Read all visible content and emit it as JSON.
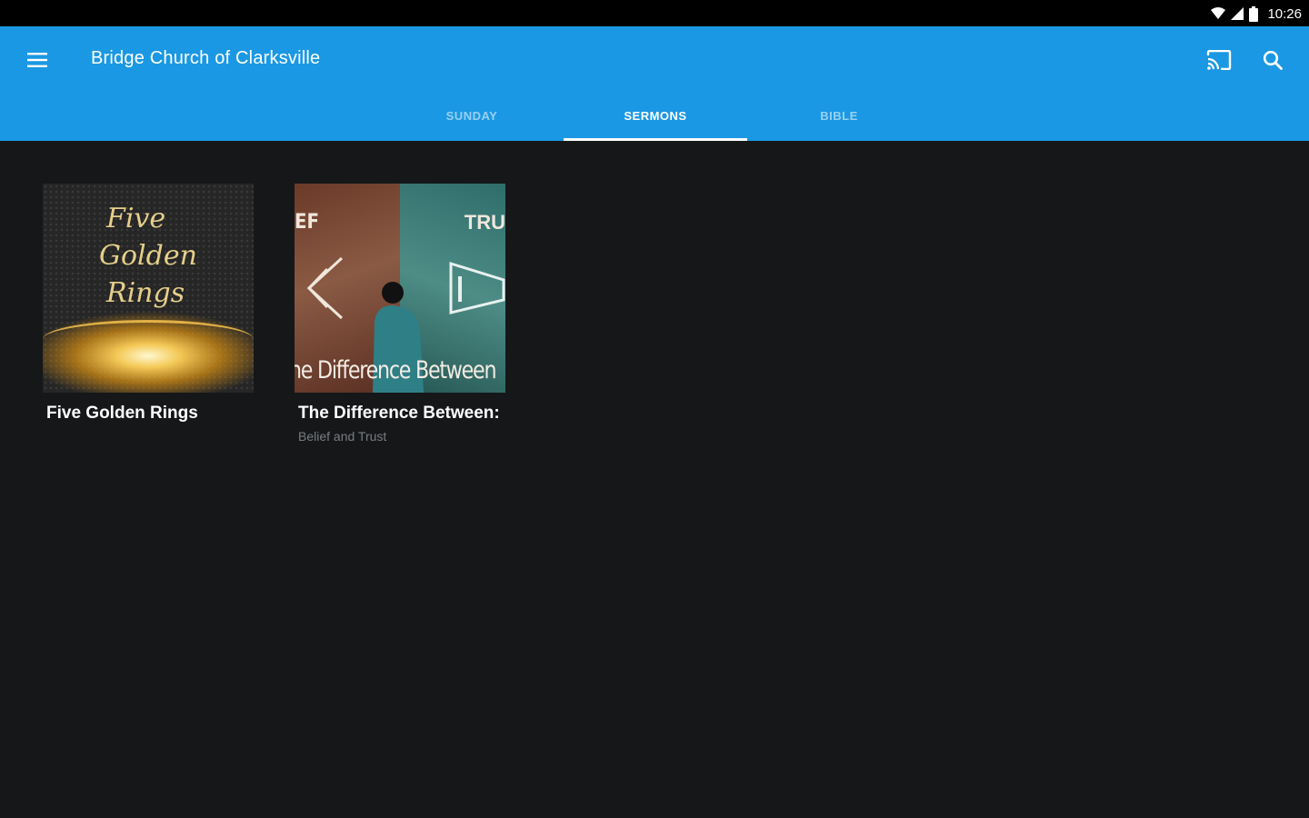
{
  "status_bar": {
    "time": "10:26",
    "icons": [
      "wifi-icon",
      "cell-signal-icon",
      "battery-icon"
    ]
  },
  "app_bar": {
    "title": "Bridge Church of Clarksville",
    "color": "#1a98e3",
    "icons": {
      "menu": "menu-icon",
      "cast": "cast-icon",
      "search": "search-icon"
    }
  },
  "tabs": [
    {
      "label": "SUNDAY",
      "active": false
    },
    {
      "label": "SERMONS",
      "active": true
    },
    {
      "label": "BIBLE",
      "active": false
    }
  ],
  "sermons": [
    {
      "title": "Five Golden Rings",
      "subtitle": "",
      "art": {
        "lines": [
          "Five",
          "Golden",
          "Rings"
        ]
      }
    },
    {
      "title": "The Difference Between:",
      "subtitle": "Belief and Trust",
      "art": {
        "left_word": "EF",
        "right_word": "TRU",
        "caption": "he Difference Between"
      }
    }
  ]
}
